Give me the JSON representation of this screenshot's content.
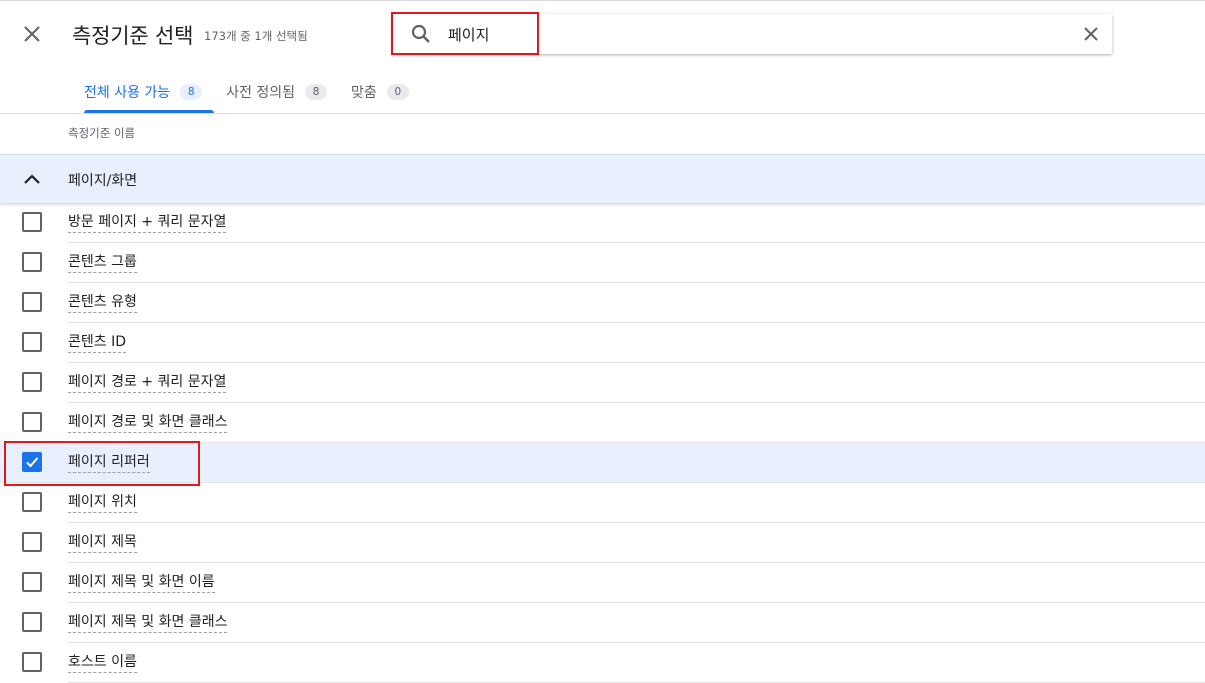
{
  "header": {
    "title": "측정기준 선택",
    "subtitle": "173개 중 1개 선택됨"
  },
  "search": {
    "value": "페이지",
    "placeholder": ""
  },
  "tabs": [
    {
      "label": "전체 사용 가능",
      "count": "8",
      "active": true
    },
    {
      "label": "사전 정의됨",
      "count": "8",
      "active": false
    },
    {
      "label": "맞춤",
      "count": "0",
      "active": false
    }
  ],
  "column_header": "측정기준 이름",
  "group": {
    "label": "페이지/화면",
    "expanded": true
  },
  "items": [
    {
      "label": "방문 페이지 + 쿼리 문자열",
      "checked": false
    },
    {
      "label": "콘텐츠 그룹",
      "checked": false
    },
    {
      "label": "콘텐츠 유형",
      "checked": false
    },
    {
      "label": "콘텐츠 ID",
      "checked": false
    },
    {
      "label": "페이지 경로 + 쿼리 문자열",
      "checked": false
    },
    {
      "label": "페이지 경로 및 화면 클래스",
      "checked": false
    },
    {
      "label": "페이지 리퍼러",
      "checked": true
    },
    {
      "label": "페이지 위치",
      "checked": false
    },
    {
      "label": "페이지 제목",
      "checked": false
    },
    {
      "label": "페이지 제목 및 화면 이름",
      "checked": false
    },
    {
      "label": "페이지 제목 및 화면 클래스",
      "checked": false
    },
    {
      "label": "호스트 이름",
      "checked": false
    }
  ],
  "colors": {
    "accent": "#1a73e8",
    "selected_row": "#e8f0fe",
    "highlight": "#e0191f"
  },
  "icons": [
    "close-icon",
    "search-icon",
    "clear-search-icon",
    "chevron-up-icon",
    "checkmark-icon"
  ]
}
